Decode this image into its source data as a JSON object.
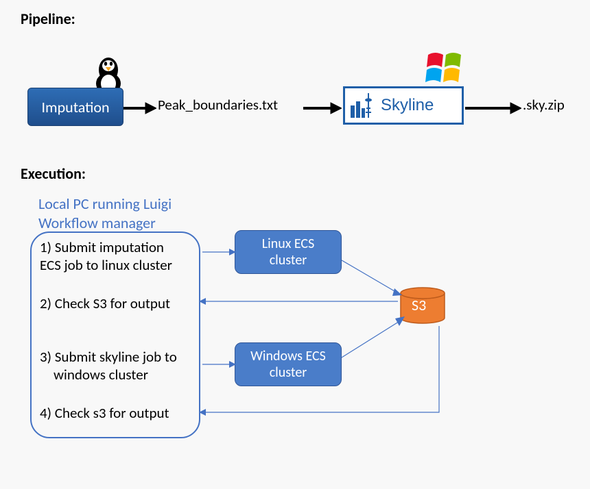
{
  "headings": {
    "pipeline": "Pipeline:",
    "execution": "Execution:"
  },
  "pipeline": {
    "imputation_label": "Imputation",
    "peak_file": "Peak_boundaries.txt",
    "skyline_label": "Skyline",
    "output_ext": ".sky.zip"
  },
  "execution": {
    "luigi_title_line1": "Local PC running Luigi",
    "luigi_title_line2": "Workflow manager",
    "steps": {
      "s1_line1": "1) Submit imputation",
      "s1_line2": "ECS job to linux cluster",
      "s2": "2) Check S3 for output",
      "s3_line1": "3) Submit skyline job to",
      "s3_line2": "windows cluster",
      "s4": "4) Check s3 for output"
    },
    "linux_ecs_line1": "Linux ECS",
    "linux_ecs_line2": "cluster",
    "windows_ecs_line1": "Windows ECS",
    "windows_ecs_line2": "cluster",
    "s3_label": "S3"
  }
}
